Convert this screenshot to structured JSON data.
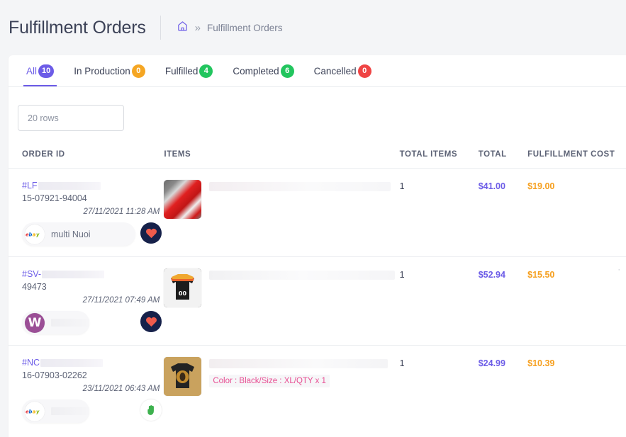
{
  "header": {
    "title": "Fulfillment Orders",
    "breadcrumb": {
      "home_icon": "home-icon",
      "separator": "»",
      "current": "Fulfillment Orders"
    }
  },
  "tabs": [
    {
      "label": "All",
      "count": "10",
      "badge_color": "#6c5ce7",
      "active": true
    },
    {
      "label": "In Production",
      "count": "0",
      "badge_color": "#f5a623",
      "active": false
    },
    {
      "label": "Fulfilled",
      "count": "4",
      "badge_color": "#22c55e",
      "active": false
    },
    {
      "label": "Completed",
      "count": "6",
      "badge_color": "#22c55e",
      "active": false
    },
    {
      "label": "Cancelled",
      "count": "0",
      "badge_color": "#ef4444",
      "active": false
    }
  ],
  "toolbar": {
    "rows_select_value": "20 rows"
  },
  "table": {
    "columns": [
      "ORDER ID",
      "ITEMS",
      "TOTAL ITEMS",
      "TOTAL",
      "FULFILLMENT COST"
    ],
    "rows": [
      {
        "order_prefix": "#LF",
        "order_sub": "15-07921-94004",
        "date": "27/11/2021 11:28 AM",
        "store_icon": "ebay-icon",
        "store_name": "multi Nuoi",
        "platform_icon": "shipstation-heart-icon",
        "thumb": "red-white-jersey-thumbnail",
        "variant": "",
        "total_items": "1",
        "total": "$41.00",
        "fulfillment_cost": "$19.00"
      },
      {
        "order_prefix": "#SV-",
        "order_sub": "49473",
        "date": "27/11/2021 07:49 AM",
        "store_icon": "woocommerce-icon",
        "store_name": "",
        "platform_icon": "shipstation-heart-icon",
        "thumb": "black-baseball-jersey-thumbnail",
        "variant": "",
        "total_items": "1",
        "total": "$52.94",
        "fulfillment_cost": "$15.50"
      },
      {
        "order_prefix": "#NC",
        "order_sub": "16-07903-02262",
        "date": "23/11/2021 06:43 AM",
        "store_icon": "ebay-icon",
        "store_name": "",
        "platform_icon": "green-hand-icon",
        "thumb": "black-graphic-tshirt-thumbnail",
        "variant": "Color : Black/Size : XL/QTY x 1",
        "total_items": "1",
        "total": "$24.99",
        "fulfillment_cost": "$10.39"
      }
    ]
  },
  "colors": {
    "accent": "#6c5ce7",
    "cost": "#f6a020",
    "variant": "#e84f93"
  }
}
